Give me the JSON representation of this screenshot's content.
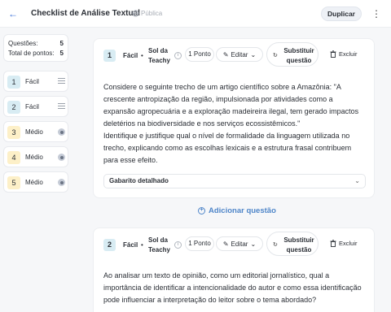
{
  "header": {
    "title": "Checklist de Análise Textual",
    "visibility": "Pública",
    "duplicate_label": "Duplicar"
  },
  "summary": {
    "questions_label": "Questões:",
    "questions_value": "5",
    "points_label": "Total de pontos:",
    "points_value": "5"
  },
  "sidebar_items": [
    {
      "number": "1",
      "difficulty": "Fácil",
      "icon": "lines-icon",
      "color": "#d8ecf3"
    },
    {
      "number": "2",
      "difficulty": "Fácil",
      "icon": "lines-icon",
      "color": "#d8ecf3"
    },
    {
      "number": "3",
      "difficulty": "Médio",
      "icon": "radio-icon",
      "color": "#fdf0c8"
    },
    {
      "number": "4",
      "difficulty": "Médio",
      "icon": "radio-icon",
      "color": "#fdf0c8"
    },
    {
      "number": "5",
      "difficulty": "Médio",
      "icon": "radio-icon",
      "color": "#fdf0c8"
    }
  ],
  "questions": [
    {
      "number": "1",
      "level": "Fácil",
      "source": "Sol da Teachy",
      "points": "1 Ponto",
      "edit_label": "Editar",
      "replace_label": "Substituir questão",
      "delete_label": "Excluir",
      "text_1": "Considere o seguinte trecho de um artigo científico sobre a Amazônia: \"A crescente antropização da região, impulsionada por atividades como a expansão agropecuária e a exploração madeireira ilegal, tem gerado impactos deletérios na biodiversidade e nos serviços ecossistêmicos.\"",
      "text_2": "Identifique e justifique qual o nível de formalidade da linguagem utilizada no trecho, explicando como as escolhas lexicais e a estrutura frasal contribuem para esse efeito.",
      "answer_label": "Gabarito detalhado"
    },
    {
      "number": "2",
      "level": "Fácil",
      "source": "Sol da Teachy",
      "points": "1 Ponto",
      "edit_label": "Editar",
      "replace_label": "Substituir questão",
      "delete_label": "Excluir",
      "text_1": "Ao analisar um texto de opinião, como um editorial jornalístico, qual a importância de identificar a intencionalidade do autor e como essa identificação pode influenciar a interpretação do leitor sobre o tema abordado?"
    }
  ],
  "add_question_label": "Adicionar questão"
}
